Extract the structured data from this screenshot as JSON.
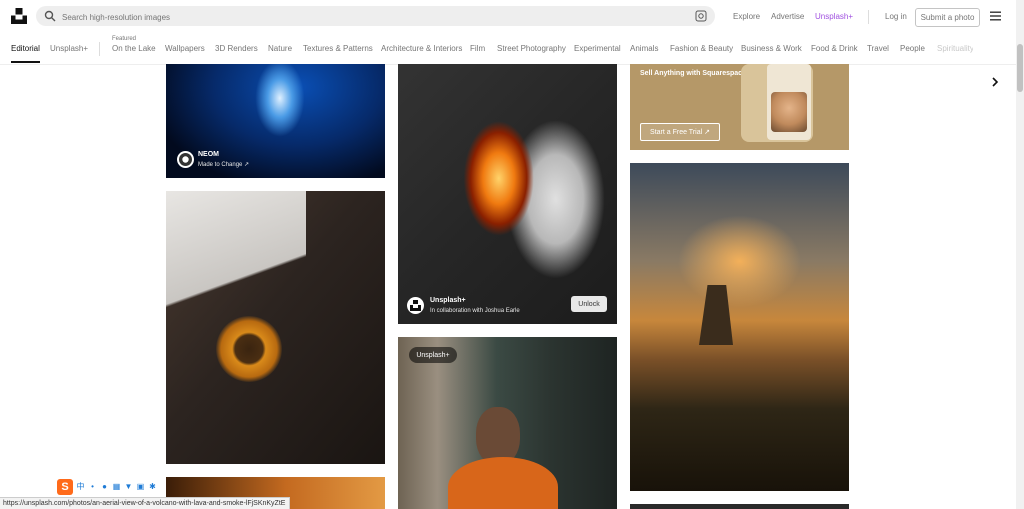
{
  "header": {
    "search_placeholder": "Search high-resolution images",
    "nav": {
      "explore": "Explore",
      "advertise": "Advertise",
      "unsplash_plus": "Unsplash+",
      "login": "Log in",
      "submit": "Submit a photo"
    },
    "colors": {
      "unsplash_plus": "#a050e0"
    }
  },
  "tabs": {
    "editorial": "Editorial",
    "unsplash_plus": "Unsplash+",
    "featured_label": "Featured",
    "items": [
      "On the Lake",
      "Wallpapers",
      "3D Renders",
      "Nature",
      "Textures & Patterns",
      "Architecture & Interiors",
      "Film",
      "Street Photography",
      "Experimental",
      "Animals",
      "Fashion & Beauty",
      "Business & Work",
      "Food & Drink",
      "Travel",
      "People",
      "Spirituality"
    ]
  },
  "photos": {
    "neom": {
      "name": "NEOM",
      "sub": "Made to Change ↗"
    },
    "volcano": {
      "name": "Unsplash+",
      "sub": "In collaboration with Joshua Earle",
      "unlock": "Unlock"
    },
    "ad": {
      "title": "Sell Anything with Squarespace",
      "cta": "Start a Free Trial ↗"
    },
    "portrait": {
      "badge": "Unsplash+"
    }
  },
  "status_url": "https://unsplash.com/photos/an-aerial-view-of-a-volcano-with-lava-and-smoke-lFjSKnKyZtE"
}
